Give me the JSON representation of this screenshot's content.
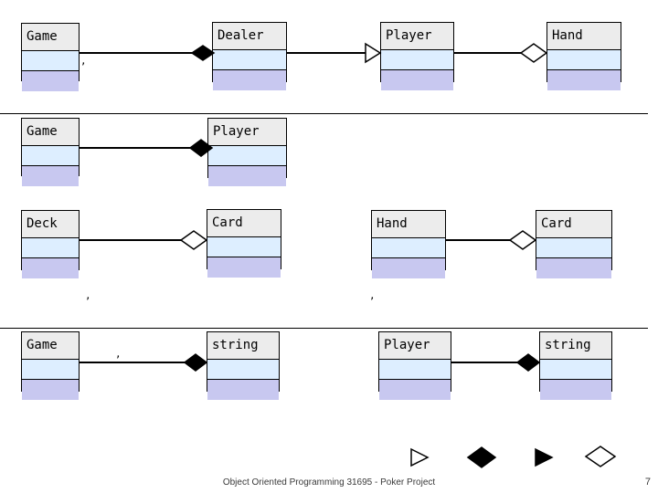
{
  "slide": {
    "footer_text": "Object Oriented Programming 31695 - Poker Project",
    "page_number": "7",
    "colors": {
      "title_fill": "#ececec",
      "attr_fill": "#ddeeff",
      "ops_fill": "#c8c8f0",
      "line": "#000000",
      "marker_fill": "#000000",
      "hollow_fill": "#ffffff"
    }
  },
  "rows": [
    {
      "id": "row-1",
      "classes": [
        {
          "name": "Game"
        },
        {
          "name": "Dealer"
        },
        {
          "name": "Player"
        },
        {
          "name": "Hand"
        }
      ],
      "relations": [
        {
          "from": "Game",
          "to": "Dealer",
          "marker": "filled-diamond"
        },
        {
          "from": "Dealer",
          "to": "Player",
          "marker": "hollow-triangle"
        },
        {
          "from": "Player",
          "to": "Hand",
          "marker": "hollow-diamond"
        }
      ]
    },
    {
      "id": "row-2",
      "classes": [
        {
          "name": "Game"
        },
        {
          "name": "Player"
        }
      ],
      "relations": [
        {
          "from": "Game",
          "to": "Player",
          "marker": "filled-diamond"
        }
      ]
    },
    {
      "id": "row-3",
      "classes": [
        {
          "name": "Deck"
        },
        {
          "name": "Card"
        },
        {
          "name": "Hand"
        },
        {
          "name": "Card"
        }
      ],
      "relations": [
        {
          "from": "Deck",
          "to": "Card",
          "marker": "hollow-diamond"
        },
        {
          "from": "Hand",
          "to": "Card",
          "marker": "hollow-diamond"
        }
      ]
    },
    {
      "id": "row-4",
      "classes": [
        {
          "name": "Game"
        },
        {
          "name": "string"
        },
        {
          "name": "Player"
        },
        {
          "name": "string"
        }
      ],
      "relations": [
        {
          "from": "Game",
          "to": "string",
          "marker": "filled-diamond"
        },
        {
          "from": "Player",
          "to": "string",
          "marker": "filled-diamond"
        }
      ]
    }
  ],
  "legend": {
    "markers": [
      {
        "name": "hollow-triangle"
      },
      {
        "name": "filled-diamond"
      },
      {
        "name": "filled-triangle"
      },
      {
        "name": "hollow-diamond"
      }
    ]
  },
  "tick_marks": [
    {
      "label": ","
    },
    {
      "label": ","
    },
    {
      "label": ","
    },
    {
      "label": ","
    },
    {
      "label": ","
    }
  ]
}
